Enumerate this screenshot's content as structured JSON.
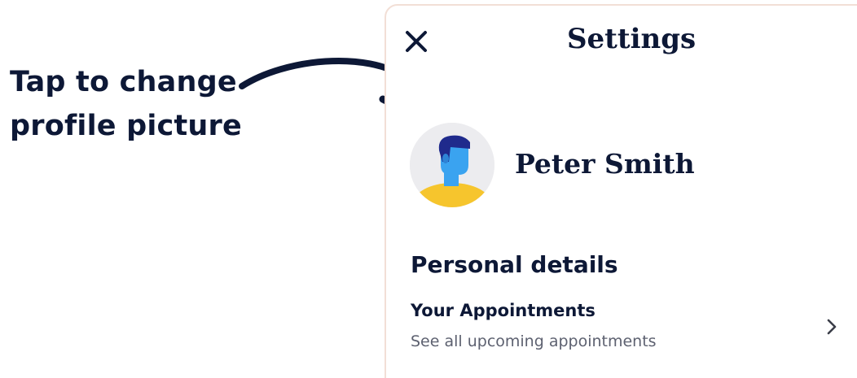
{
  "annotation": {
    "line1": "Tap to change",
    "line2": "profile picture"
  },
  "header": {
    "title": "Settings",
    "close_icon": "close-icon"
  },
  "profile": {
    "name": "Peter Smith",
    "avatar_icon": "user-avatar-icon"
  },
  "personal_details": {
    "heading": "Personal details",
    "items": [
      {
        "title": "Your Appointments",
        "subtitle": "See all upcoming appointments",
        "icon": "chevron-right-icon"
      }
    ]
  },
  "colors": {
    "text_dark": "#0d1836",
    "text_muted": "#5d6170",
    "panel_border": "#f2dfd6",
    "avatar_bg": "#ececef",
    "avatar_shirt": "#f6c52d",
    "avatar_skin": "#3aa3f0",
    "avatar_hair": "#1f2a8c"
  }
}
